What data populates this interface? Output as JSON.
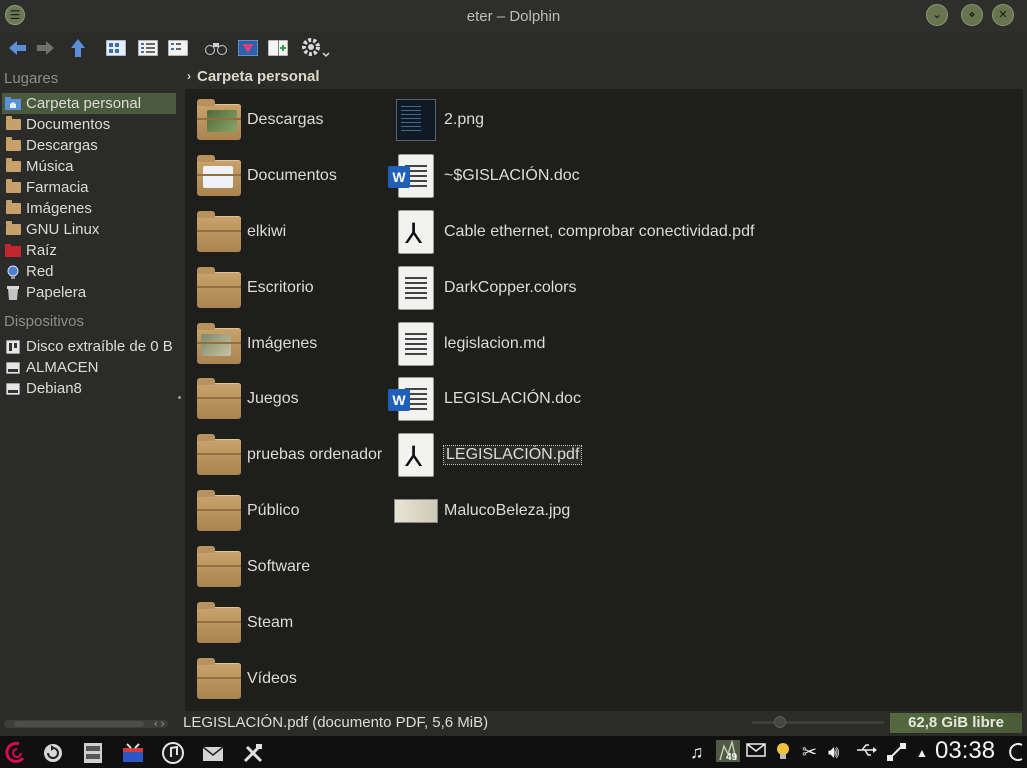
{
  "window": {
    "title": "eter – Dolphin"
  },
  "title_buttons": {
    "menu": "☰",
    "minimize": "⌄",
    "maximize": "⋄",
    "close": "✕"
  },
  "sidebar": {
    "places_title": "Lugares",
    "places": [
      {
        "label": "Carpeta personal",
        "icon": "home-folder-icon",
        "active": true
      },
      {
        "label": "Documentos",
        "icon": "folder-icon"
      },
      {
        "label": "Descargas",
        "icon": "folder-icon"
      },
      {
        "label": "Música",
        "icon": "folder-icon"
      },
      {
        "label": "Farmacia",
        "icon": "folder-icon"
      },
      {
        "label": "Imágenes",
        "icon": "folder-icon"
      },
      {
        "label": "GNU Linux",
        "icon": "folder-icon"
      },
      {
        "label": "Raíz",
        "icon": "root-folder-icon"
      },
      {
        "label": "Red",
        "icon": "network-globe-icon"
      },
      {
        "label": "Papelera",
        "icon": "trash-icon"
      }
    ],
    "devices_title": "Dispositivos",
    "devices": [
      {
        "label": "Disco extraíble de 0 B",
        "icon": "removable-drive-icon"
      },
      {
        "label": "ALMACEN",
        "icon": "hard-drive-icon"
      },
      {
        "label": "Debian8",
        "icon": "hard-drive-icon"
      }
    ]
  },
  "breadcrumb": {
    "current": "Carpeta personal"
  },
  "folders": [
    {
      "label": "Descargas",
      "emblem": "download"
    },
    {
      "label": "Documentos",
      "emblem": "documents"
    },
    {
      "label": "elkiwi",
      "emblem": ""
    },
    {
      "label": "Escritorio",
      "emblem": ""
    },
    {
      "label": "Imágenes",
      "emblem": "pictures"
    },
    {
      "label": "Juegos",
      "emblem": ""
    },
    {
      "label": "pruebas ordenador",
      "emblem": ""
    },
    {
      "label": "Público",
      "emblem": ""
    },
    {
      "label": "Software",
      "emblem": ""
    },
    {
      "label": "Steam",
      "emblem": ""
    },
    {
      "label": "Vídeos",
      "emblem": ""
    }
  ],
  "files": [
    {
      "label": "2.png",
      "type": "png"
    },
    {
      "label": "~$GISLACIÓN.doc",
      "type": "doc"
    },
    {
      "label": "Cable ethernet, comprobar conectividad.pdf",
      "type": "pdf"
    },
    {
      "label": "DarkCopper.colors",
      "type": "text"
    },
    {
      "label": "legislacion.md",
      "type": "text"
    },
    {
      "label": "LEGISLACIÓN.doc",
      "type": "doc"
    },
    {
      "label": "LEGISLACIÓN.pdf",
      "type": "pdf",
      "selected": true
    },
    {
      "label": "MalucoBeleza.jpg",
      "type": "jpg"
    }
  ],
  "status": {
    "text": "LEGISLACIÓN.pdf (documento PDF, 5,6 MiB)",
    "free_space": "62,8 GiB libre",
    "scroll_arrows": "‹ ›"
  },
  "taskbar": {
    "clock": "03:38",
    "badge": "49"
  },
  "colors": {
    "accent": "#4a5a3e",
    "free_space_bar": "#55693f",
    "view_bg": "#1e1e1d"
  }
}
